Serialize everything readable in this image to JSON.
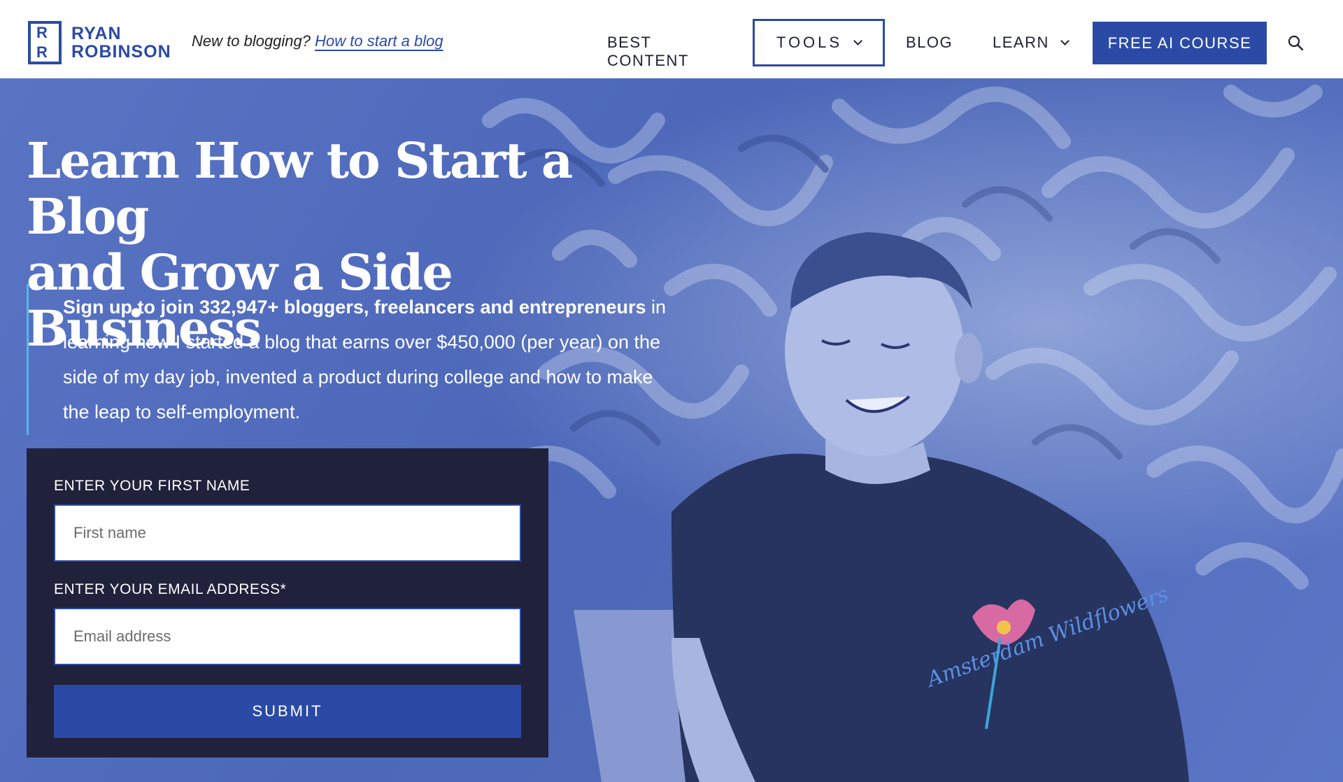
{
  "header": {
    "logo": {
      "line1": "RYAN",
      "line2": "ROBINSON",
      "mark_top": "R",
      "mark_bottom": "R"
    },
    "tagline": {
      "prefix": "New to blogging?",
      "link": "How to start a blog"
    },
    "nav": {
      "best_content": "BEST CONTENT",
      "tools": "TOOLS",
      "blog": "BLOG",
      "learn": "LEARN",
      "cta": "FREE AI COURSE"
    },
    "icons": {
      "search": "search-icon",
      "chevron": "chevron-down-icon"
    }
  },
  "hero": {
    "title_line1": "Learn How to Start a Blog",
    "title_line2": "and Grow a Side Business",
    "desc_bold": "Sign up to join 332,947+ bloggers, freelancers and entrepreneurs",
    "desc_rest": " in learning how I started a blog that earns over $450,000 (per year) on the side of my day job, invented a product during college and how to make the leap to self-employment.",
    "shirt_text": "Amsterdam Wildflowers"
  },
  "form": {
    "first_name_label": "ENTER YOUR FIRST NAME",
    "first_name_placeholder": "First name",
    "email_label": "ENTER YOUR EMAIL ADDRESS*",
    "email_placeholder": "Email address",
    "submit_label": "SUBMIT"
  },
  "colors": {
    "brand": "#2a4aa6",
    "dark": "#20213a",
    "accent_border": "#55b6e8"
  }
}
